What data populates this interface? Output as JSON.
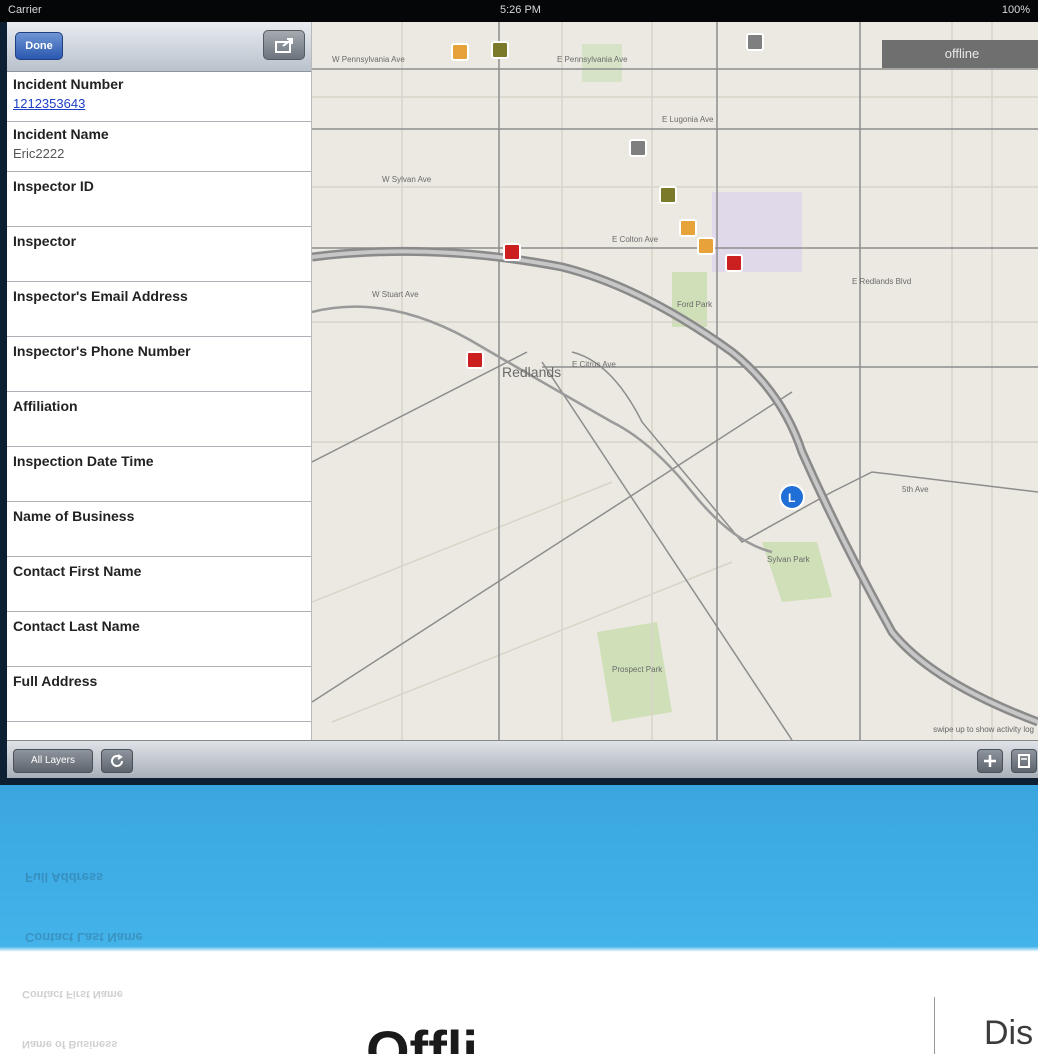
{
  "status_bar": {
    "carrier": "Carrier",
    "time": "5:26 PM",
    "battery": "100%"
  },
  "form": {
    "done_label": "Done",
    "fields": [
      {
        "label": "Incident Number",
        "value": "1212353643",
        "link": true
      },
      {
        "label": "Incident Name",
        "value": "Eric2222"
      },
      {
        "label": "Inspector ID",
        "value": ""
      },
      {
        "label": "Inspector",
        "value": ""
      },
      {
        "label": "Inspector's Email Address",
        "value": ""
      },
      {
        "label": "Inspector's Phone Number",
        "value": ""
      },
      {
        "label": "Affiliation",
        "value": ""
      },
      {
        "label": "Inspection Date Time",
        "value": ""
      },
      {
        "label": "Name of Business",
        "value": ""
      },
      {
        "label": "Contact First Name",
        "value": ""
      },
      {
        "label": "Contact Last Name",
        "value": ""
      },
      {
        "label": "Full Address",
        "value": ""
      }
    ]
  },
  "map": {
    "offline_label": "offline",
    "swipe_hint": "swipe up to show activity log",
    "city_label": "Redlands",
    "streets": [
      "W Pennsylvania Ave",
      "E Pennsylvania Ave",
      "E Lugonia Ave",
      "W Sylvan Ave",
      "E Colton Ave",
      "W Stuart Ave",
      "E Redlands Blvd",
      "E Citrus Ave",
      "5th Ave"
    ],
    "parks": [
      "Ford Park",
      "Prospect Park",
      "Sylvan Park"
    ],
    "marker_colors": {
      "orange": "#e8a23a",
      "olive": "#7a7a2a",
      "gray": "#7f7f7f",
      "red": "#cc1f1f",
      "location": "#1f6fd6"
    }
  },
  "toolbar": {
    "layers_label": "All Layers",
    "refresh_icon": "refresh-icon",
    "add_icon": "plus-icon",
    "save_icon": "save-icon"
  },
  "reflection": {
    "mirror_texts": [
      "Full Address",
      "Contact Last Name"
    ],
    "ghost_texts": [
      "Contact First Name",
      "Name of Business"
    ]
  },
  "title": {
    "main": "Offli",
    "secondary": "Dis"
  }
}
